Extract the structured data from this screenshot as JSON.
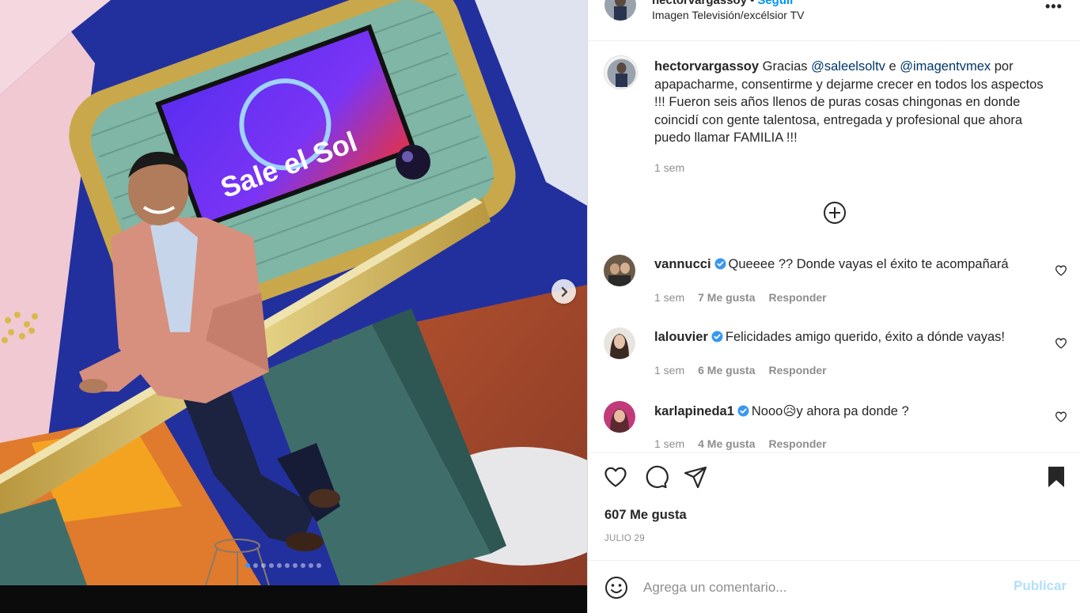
{
  "post": {
    "username": "hectorvargassoy",
    "separator": "•",
    "follow_label": "Seguir",
    "location": "Imagen Televisión/excélsior TV",
    "more_label": "•••",
    "image_sign_text": "Sale el Sol"
  },
  "caption": {
    "username": "hectorvargassoy",
    "text_a": " Gracias ",
    "mention1": "@saleelsoltv",
    "text_b": " e ",
    "mention2": "@imagentvmex",
    "text_c": " por apapacharme, consentirme y dejarme crecer en todos los aspectos !!! Fueron seis años llenos de puras cosas chingonas en donde coincidí con gente talentosa, entregada y profesional que ahora puedo llamar FAMILIA !!!",
    "time": "1 sem"
  },
  "comments": [
    {
      "username": "vannucci",
      "text": "Queeee ?? Donde vayas el éxito te acompañará",
      "time": "1 sem",
      "likes": "7 Me gusta",
      "reply": "Responder"
    },
    {
      "username": "lalouvier",
      "text": "Felicidades amigo querido, éxito a dónde vayas!",
      "time": "1 sem",
      "likes": "6 Me gusta",
      "reply": "Responder"
    },
    {
      "username": "karlapineda1",
      "text_a": "Nooo",
      "emoji": "😥",
      "text_b": "y ahora pa donde ?",
      "time": "1 sem",
      "likes": "4 Me gusta",
      "reply": "Responder"
    }
  ],
  "stats": {
    "likes": "607 Me gusta",
    "date": "JULIO 29"
  },
  "compose": {
    "placeholder": "Agrega un comentario...",
    "publish_label": "Publicar"
  },
  "carousel": {
    "total": 10,
    "current": 1
  },
  "colors": {
    "accent": "#0095f6",
    "verified": "#3897f0",
    "publish_disabled": "#b2dffc",
    "mention": "#00376b"
  }
}
